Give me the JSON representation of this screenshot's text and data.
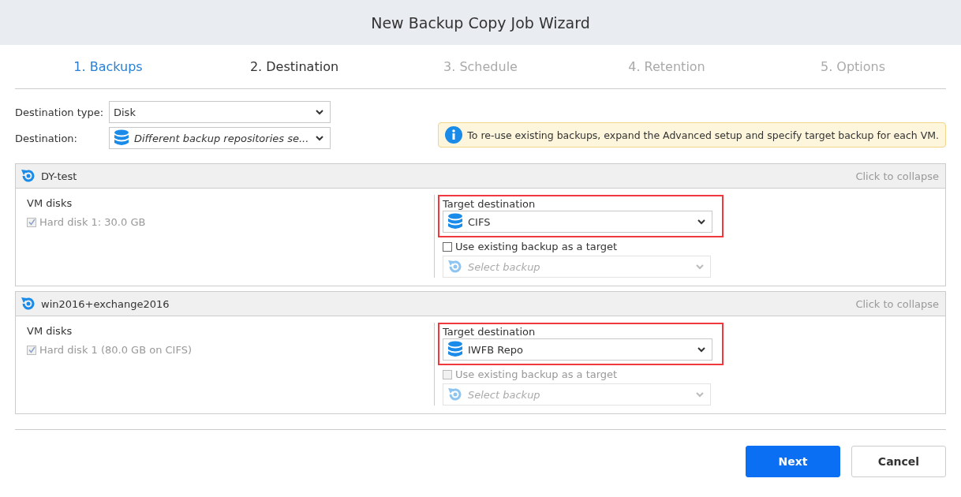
{
  "window": {
    "title": "New Backup Copy Job Wizard"
  },
  "steps": [
    {
      "label": "1. Backups",
      "selected": false
    },
    {
      "label": "2. Destination",
      "selected": true
    },
    {
      "label": "3. Schedule",
      "selected": false
    },
    {
      "label": "4. Retention",
      "selected": false
    },
    {
      "label": "5. Options",
      "selected": false
    }
  ],
  "form": {
    "destination_type": {
      "label": "Destination type:",
      "value": "Disk"
    },
    "destination": {
      "label": "Destination:",
      "value": "Different backup repositories se..."
    }
  },
  "info": "To re-use existing backups, expand the Advanced setup and specify target backup for each VM.",
  "jobs": [
    {
      "name": "DY-test",
      "collapse": "Click to collapse",
      "vm_disks_label": "VM disks",
      "disk": {
        "label": "Hard disk 1: 30.0 GB",
        "checked": true,
        "disabled": true
      },
      "target": {
        "label": "Target destination",
        "value": "CIFS",
        "highlighted": true
      },
      "use_existing": {
        "label": "Use existing backup as a target",
        "checked": false,
        "disabled": false
      },
      "select_backup": {
        "placeholder": "Select backup"
      }
    },
    {
      "name": "win2016+exchange2016",
      "collapse": "Click to collapse",
      "vm_disks_label": "VM disks",
      "disk": {
        "label": "Hard disk 1 (80.0 GB on CIFS)",
        "checked": true,
        "disabled": true
      },
      "target": {
        "label": "Target destination",
        "value": "IWFB Repo",
        "highlighted": true
      },
      "use_existing": {
        "label": "Use existing backup as a target",
        "checked": false,
        "disabled": true
      },
      "select_backup": {
        "placeholder": "Select backup"
      }
    }
  ],
  "buttons": {
    "next": "Next",
    "cancel": "Cancel"
  }
}
